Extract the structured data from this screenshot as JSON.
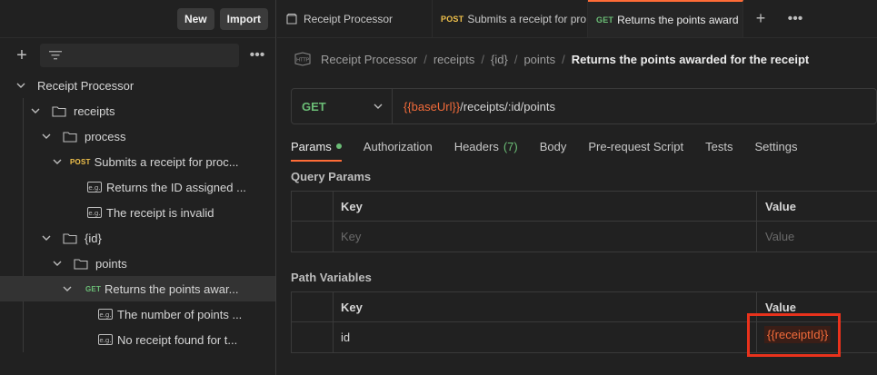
{
  "sidebar": {
    "new_label": "New",
    "import_label": "Import",
    "more_icon": "ooo",
    "tree": [
      {
        "type": "collection",
        "label": "Receipt Processor",
        "depth": 0,
        "expanded": true
      },
      {
        "type": "folder",
        "label": "receipts",
        "depth": 1,
        "expanded": true
      },
      {
        "type": "folder",
        "label": "process",
        "depth": 2,
        "expanded": true
      },
      {
        "type": "request",
        "method": "POST",
        "label": "Submits a receipt for proc...",
        "depth": 3,
        "expanded": true
      },
      {
        "type": "example",
        "label": "Returns the ID assigned ...",
        "depth": 4
      },
      {
        "type": "example",
        "label": "The receipt is invalid",
        "depth": 4
      },
      {
        "type": "folder",
        "label": "{id}",
        "depth": 2,
        "expanded": true
      },
      {
        "type": "folder",
        "label": "points",
        "depth": 3,
        "expanded": true
      },
      {
        "type": "request",
        "method": "GET",
        "label": "Returns the points awar...",
        "depth": 4,
        "expanded": true,
        "selected": true
      },
      {
        "type": "example",
        "label": "The number of points ...",
        "depth": 5
      },
      {
        "type": "example",
        "label": "No receipt found for t...",
        "depth": 5
      }
    ]
  },
  "tabs": [
    {
      "icon": "collection-icon",
      "method": "",
      "label": "Receipt Processor",
      "active": false
    },
    {
      "icon": "",
      "method": "POST",
      "label": "Submits a receipt for pro",
      "active": false
    },
    {
      "icon": "",
      "method": "GET",
      "label": "Returns the points award",
      "active": true
    }
  ],
  "tab_actions": {
    "new_tab": "+",
    "more": "ooo"
  },
  "breadcrumb": {
    "icon_text": "HTTP",
    "parts": [
      "Receipt Processor",
      "receipts",
      "{id}",
      "points"
    ],
    "separator": "/",
    "current": "Returns the points awarded for the receipt"
  },
  "request": {
    "method": "GET",
    "url_variable": "{{baseUrl}}",
    "url_path": "/receipts/:id/points"
  },
  "request_tabs": [
    {
      "label": "Params",
      "active": true,
      "dot": true
    },
    {
      "label": "Authorization"
    },
    {
      "label": "Headers",
      "count": "(7)"
    },
    {
      "label": "Body"
    },
    {
      "label": "Pre-request Script"
    },
    {
      "label": "Tests"
    },
    {
      "label": "Settings"
    }
  ],
  "query_params": {
    "title": "Query Params",
    "key_header": "Key",
    "value_header": "Value",
    "key_placeholder": "Key",
    "value_placeholder": "Value"
  },
  "path_variables": {
    "title": "Path Variables",
    "key_header": "Key",
    "value_header": "Value",
    "rows": [
      {
        "key": "id",
        "value": "{{receiptId}}"
      }
    ]
  },
  "colors": {
    "accent": "#ff6c37",
    "get": "#6bbd76",
    "post": "#f0c14b",
    "variable": "#f26b3a",
    "highlight": "#e8321c"
  }
}
